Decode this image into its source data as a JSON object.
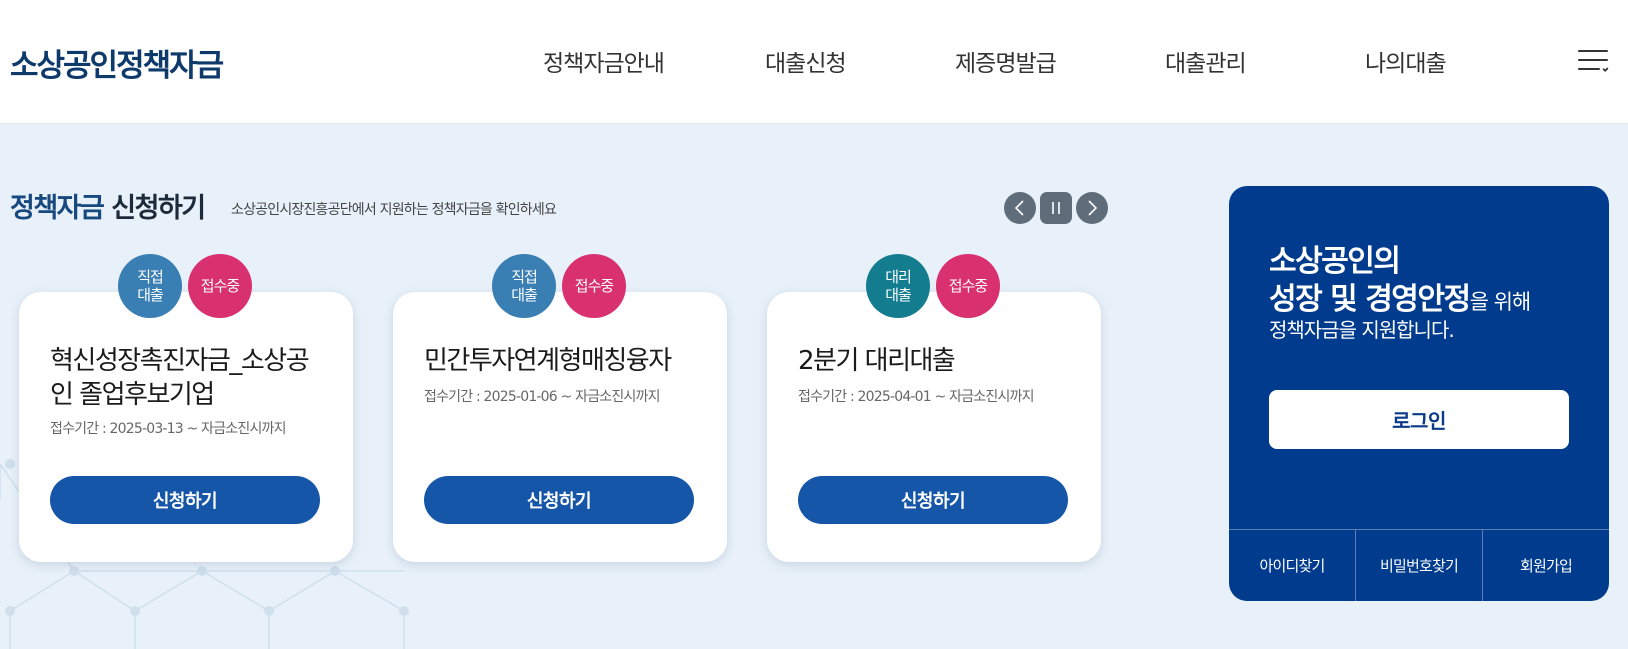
{
  "header": {
    "logo": "소상공인정책자금",
    "nav": [
      "정책자금안내",
      "대출신청",
      "제증명발급",
      "대출관리",
      "나의대출"
    ]
  },
  "section": {
    "title_accent": "정책자금",
    "title_rest": "신청하기",
    "description": "소상공인시장진흥공단에서 지원하는 정책자금을 확인하세요"
  },
  "cards": [
    {
      "type_line1": "직접",
      "type_line2": "대출",
      "status": "접수중",
      "title": "혁신성장촉진자금_소상공인 졸업후보기업",
      "period": "접수기간 : 2025-03-13 ~ 자금소진시까지",
      "button": "신청하기"
    },
    {
      "type_line1": "직접",
      "type_line2": "대출",
      "status": "접수중",
      "title": "민간투자연계형매칭융자",
      "period": "접수기간 : 2025-01-06 ~ 자금소진시까지",
      "button": "신청하기"
    },
    {
      "type_line1": "대리",
      "type_line2": "대출",
      "status": "접수중",
      "title": "2분기 대리대출",
      "period": "접수기간 : 2025-04-01 ~ 자금소진시까지",
      "button": "신청하기"
    }
  ],
  "login_panel": {
    "line1": "소상공인의",
    "line2_big": "성장 및 경영안정",
    "line2_small": "을 위해",
    "line3": "정책자금을 지원합니다.",
    "login_button": "로그인",
    "links": [
      "아이디찾기",
      "비밀번호찾기",
      "회원가입"
    ]
  },
  "colors": {
    "brand_navy": "#0d3a6b",
    "panel_blue": "#003b8e",
    "button_blue": "#1656a8",
    "badge_blue": "#3a7fb3",
    "badge_teal": "#137d8f",
    "badge_pink": "#d9306f",
    "background": "#e8f1f9"
  }
}
